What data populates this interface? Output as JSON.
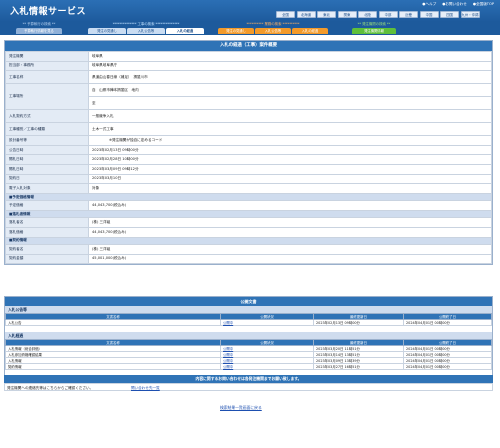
{
  "header": {
    "site_title": "入札情報サービス",
    "links": [
      "●ヘルプ",
      "●お問い合わせ",
      "●全国版TOP"
    ],
    "regions": [
      "全国",
      "北海道",
      "東北",
      "関東",
      "北陸",
      "中部",
      "近畿",
      "中国",
      "四国",
      "九州・沖縄"
    ]
  },
  "nav": {
    "groups": [
      {
        "title": "** 予算執行の検索 **",
        "tabs": [
          "予算執行情報を見る"
        ]
      },
      {
        "title": "************** 工事の検索 **************",
        "tabs": [
          "発注の見通し",
          "入札公告等",
          "入札の経過"
        ],
        "active": 2
      },
      {
        "title": "********** 業務の検索 **********",
        "tabs": [
          "発注の見通し",
          "入札公告等",
          "入札の経過"
        ]
      },
      {
        "title": "** 発注機関の検索 **",
        "tabs": [
          "発注機関情報"
        ]
      }
    ]
  },
  "detail": {
    "heading": "入札の経過（工事）案件概要",
    "rows": [
      {
        "label": "発注機関",
        "value": "岐阜県"
      },
      {
        "label": "担当部・事務所",
        "value": "岐阜県岐阜県庁"
      },
      {
        "label": "工事名称",
        "value": "県道由山春日線（補足）　揖斐川市"
      },
      {
        "label": "工事場所",
        "value": "自　山県市樺本揖斐区　地内",
        "value2": "至"
      },
      {
        "label": "入札契約方式",
        "value": "一般競争入札"
      },
      {
        "label": "工事種別／工事の種類",
        "value": "土木一式工事"
      },
      {
        "label": "設計番号等",
        "value": "※発注機関が独自に定めるコード"
      },
      {
        "label": "公告日時",
        "value": "2023年02月13日 09時00分"
      },
      {
        "label": "開札日時",
        "value": "2023年02月28日 10時00分"
      },
      {
        "label": "開札日時",
        "value": "2023年03月09日 09時12分"
      },
      {
        "label": "契約日",
        "value": "2023年03月10日"
      },
      {
        "label": "電子入札対象",
        "value": "対象"
      }
    ],
    "section_price": "■予定価格情報",
    "price_rows": [
      {
        "label": "予定価格",
        "value": "44,043,700(税込み)"
      }
    ],
    "section_winner": "■落札者情報",
    "winner_rows": [
      {
        "label": "落札者名",
        "value": "(株) 三洋組"
      },
      {
        "label": "落札価格",
        "value": "44,043,700(税込み)"
      }
    ],
    "section_contract": "■契約情報",
    "contract_rows": [
      {
        "label": "契約者名",
        "value": "(株) 三洋組"
      },
      {
        "label": "契約金額",
        "value": "45,001,000(税込み)"
      }
    ]
  },
  "docs": {
    "heading": "公開文書",
    "groups": [
      {
        "title": "入札公告等",
        "columns": [
          "文書名称",
          "公開状況",
          "最終更新日",
          "公開終了日"
        ],
        "rows": [
          [
            "入札公告",
            "公開中",
            "2023年02月13日 09時00分",
            "2024年04月01日 00時00分"
          ]
        ]
      },
      {
        "title": "入札経過",
        "columns": [
          "文書名称",
          "公開状況",
          "最終更新日",
          "公開終了日"
        ],
        "rows": [
          [
            "入札情報（総合評価）",
            "公開中",
            "2023年03月20日 11時51分",
            "2024年04月01日 00時00分"
          ],
          [
            "入札参加資格確認結果",
            "公開中",
            "2023年03月14日 13時51分",
            "2024年04月01日 00時00分"
          ],
          [
            "入札情報",
            "公開中",
            "2023年03月09日 13時39分",
            "2024年04月01日 00時00分"
          ],
          [
            "契約情報",
            "公開中",
            "2023年03月27日 16時51分",
            "2024年04月01日 00時00分"
          ]
        ]
      }
    ]
  },
  "inquiry": {
    "bar": "内容に関するお問い合わせは各発注機関までお願い致します。",
    "text": "発注機関への連絡先等はこちらからご確認ください。",
    "link": "問い合わせ先一覧"
  },
  "back_link": "検索結果一覧画面に戻る"
}
